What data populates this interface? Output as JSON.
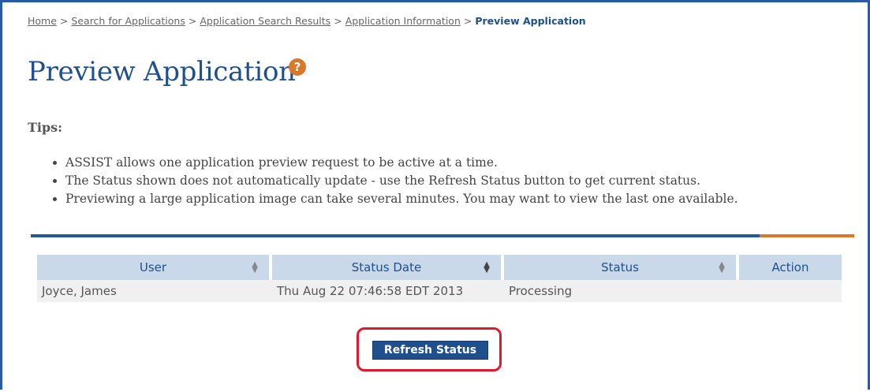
{
  "breadcrumb": {
    "items": [
      "Home",
      "Search for Applications",
      "Application Search Results",
      "Application Information"
    ],
    "current": "Preview Application",
    "separator": ">"
  },
  "page": {
    "title": "Preview Application",
    "help_icon": "?"
  },
  "tips": {
    "heading": "Tips:",
    "items": [
      "ASSIST allows one application preview request to be active at a time.",
      "The Status shown does not automatically update - use the Refresh Status button to get current status.",
      "Previewing a large application image can take several minutes.  You may want to view the last one available."
    ]
  },
  "table": {
    "columns": [
      "User",
      "Status Date",
      "Status",
      "Action"
    ],
    "rows": [
      {
        "user": "Joyce, James",
        "status_date": "Thu Aug 22 07:46:58 EDT 2013",
        "status": "Processing",
        "action": ""
      }
    ]
  },
  "actions": {
    "refresh_label": "Refresh Status"
  },
  "colors": {
    "primary": "#1f4f8c",
    "accent": "#d9782b",
    "highlight": "#e0192e"
  }
}
